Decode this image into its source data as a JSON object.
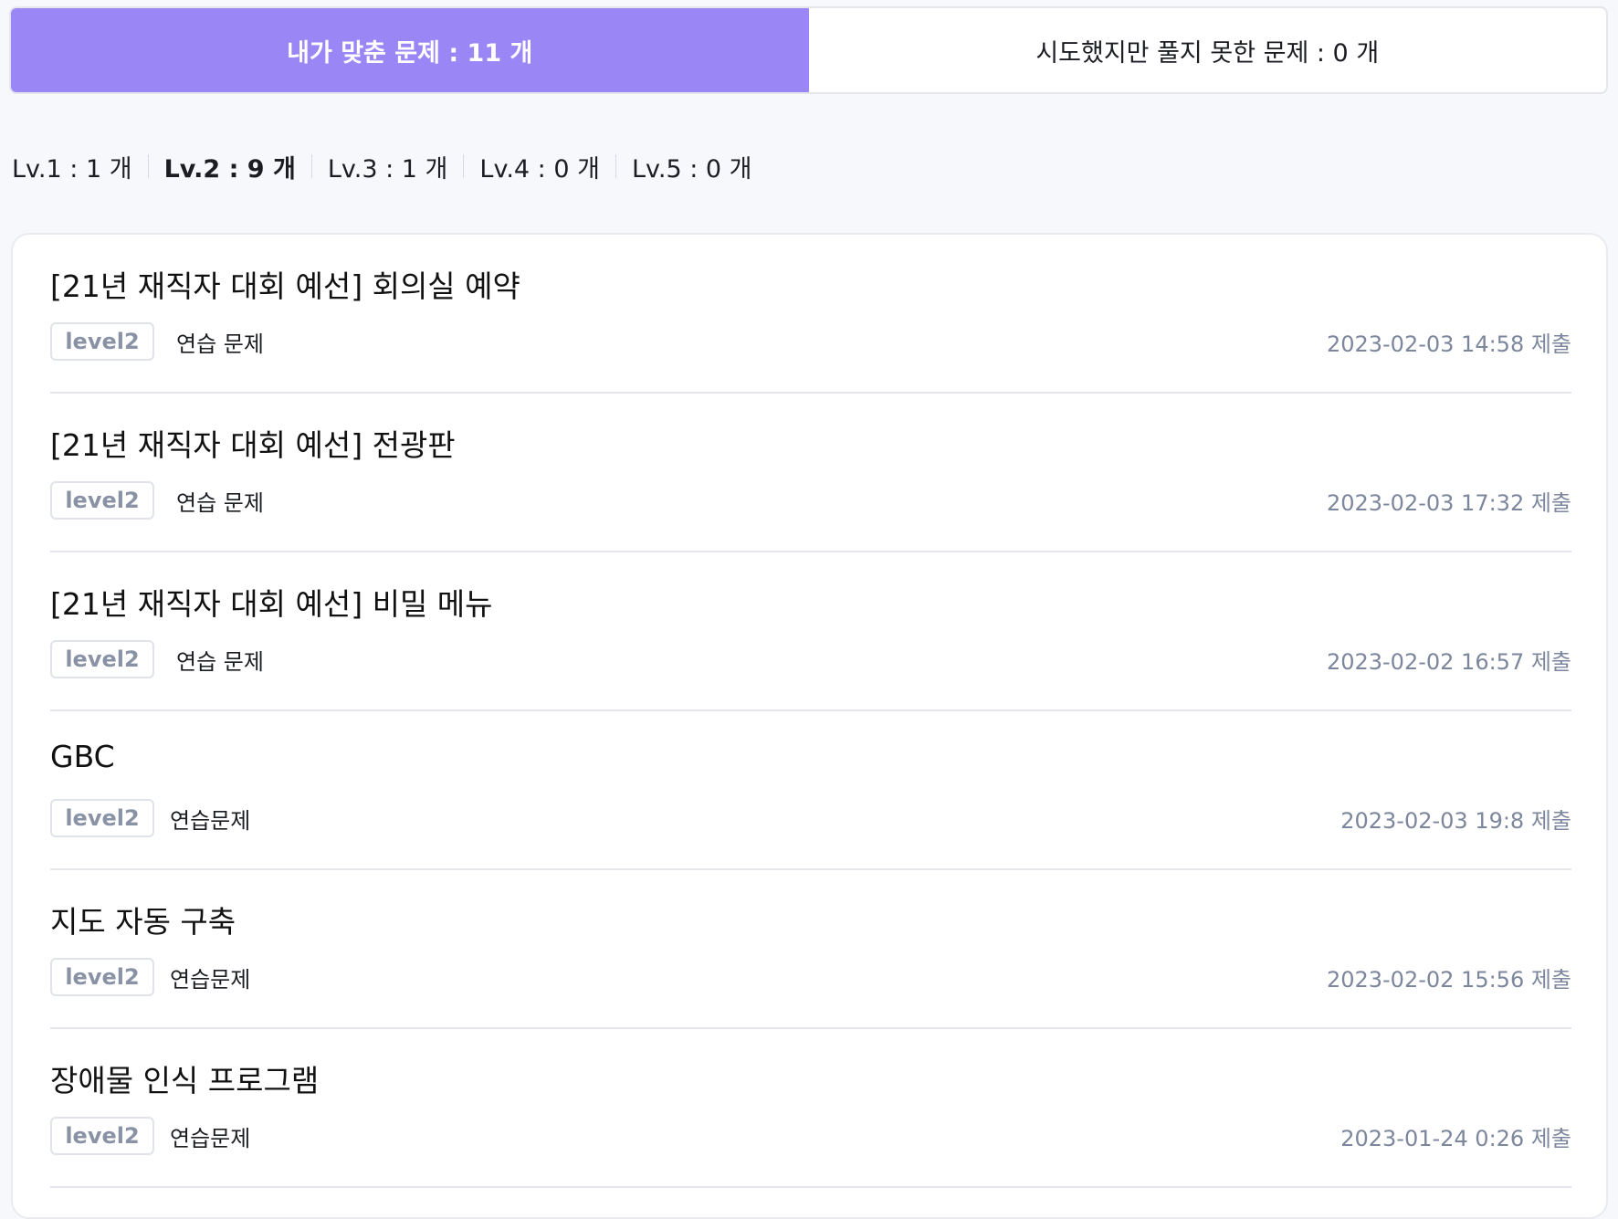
{
  "tabs": {
    "solved_label": "내가 맞춘 문제 : 11 개",
    "unsolved_label": "시도했지만 풀지 못한 문제 : 0 개",
    "active": "solved"
  },
  "levels": [
    {
      "label": "Lv.1 : 1 개",
      "selected": false
    },
    {
      "label": "Lv.2 : 9 개",
      "selected": true
    },
    {
      "label": "Lv.3 : 1 개",
      "selected": false
    },
    {
      "label": "Lv.4 : 0 개",
      "selected": false
    },
    {
      "label": "Lv.5 : 0 개",
      "selected": false
    }
  ],
  "problems": [
    {
      "title": "[21년 재직자 대회 예선] 회의실 예약",
      "level": "level2",
      "category": "연습 문제",
      "submitted": "2023-02-03 14:58 제출"
    },
    {
      "title": "[21년 재직자 대회 예선] 전광판",
      "level": "level2",
      "category": "연습 문제",
      "submitted": "2023-02-03 17:32 제출"
    },
    {
      "title": "[21년 재직자 대회 예선] 비밀 메뉴",
      "level": "level2",
      "category": "연습 문제",
      "submitted": "2023-02-02 16:57 제출"
    },
    {
      "title": "GBC",
      "level": "level2",
      "category": "연습문제",
      "submitted": "2023-02-03 19:8 제출"
    },
    {
      "title": "지도 자동 구축",
      "level": "level2",
      "category": "연습문제",
      "submitted": "2023-02-02 15:56 제출"
    },
    {
      "title": "장애물 인식 프로그램",
      "level": "level2",
      "category": "연습문제",
      "submitted": "2023-01-24 0:26 제출"
    }
  ],
  "colors": {
    "accent": "#9b86f5",
    "background": "#f7f8fb",
    "muted_text": "#7c869c"
  }
}
